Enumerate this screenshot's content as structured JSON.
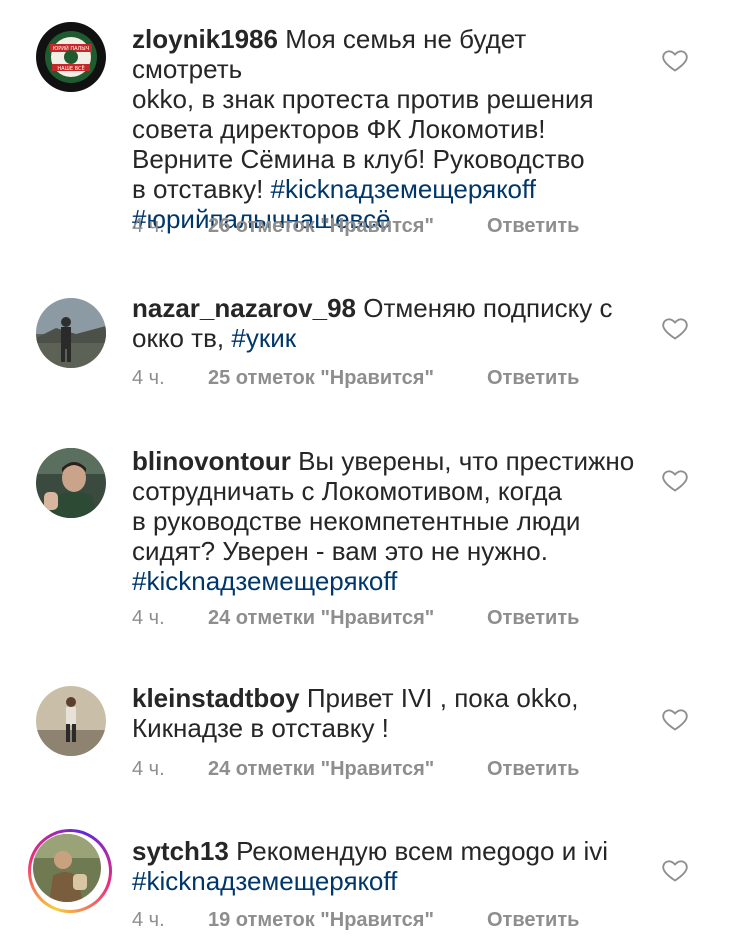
{
  "comments": [
    {
      "username": "zloynik1986",
      "text": "Моя семья не будет смотреть okko, в знак протеста против решения совета директоров ФК Локомотив! Верните Сёмина в клуб! Руководство в отставку!",
      "hashtags": [
        "#kicknадземещерякoff",
        "#юрийпалычнашевсё"
      ],
      "time": "4 ч.",
      "likes": "26 отметок \"Нравится\"",
      "reply": "Ответить",
      "avatar_icon": "club-badge-avatar"
    },
    {
      "username": "nazar_nazarov_98",
      "text": "Отменяю подписку с окко тв,",
      "hashtags": [
        "#укик"
      ],
      "time": "4 ч.",
      "likes": "25 отметок \"Нравится\"",
      "reply": "Ответить",
      "avatar_icon": "person-photo-avatar"
    },
    {
      "username": "blinovontour",
      "text": "Вы уверены, что престижно сотрудничать с Локомотивом, когда в руководстве некомпетентные люди сидят? Уверен - вам это не нужно.",
      "hashtags": [
        "#kicknадземещерякoff"
      ],
      "time": "4 ч.",
      "likes": "24 отметки \"Нравится\"",
      "reply": "Ответить",
      "avatar_icon": "person-photo-avatar"
    },
    {
      "username": "kleinstadtboy",
      "text": "Привет IVI , пока okko, Кикнадзе в отставку !",
      "hashtags": [],
      "time": "4 ч.",
      "likes": "24 отметки \"Нравится\"",
      "reply": "Ответить",
      "avatar_icon": "person-photo-avatar"
    },
    {
      "username": "sytch13",
      "text": "Рекомендую всем megogo и ivi",
      "hashtags": [
        "#kicknадземещерякoff"
      ],
      "time": "4 ч.",
      "likes": "19 отметок \"Нравится\"",
      "reply": "Ответить",
      "avatar_icon": "story-ring-avatar"
    }
  ],
  "display": {
    "c0_line1_user": "zloynik1986",
    "c0_line1_text": " Моя семья не будет смотреть",
    "c0_line2": "okko, в знак протеста против решения",
    "c0_line3": "совета директоров ФК Локомотив!",
    "c0_line4": "Верните Сёмина в клуб! Руководство",
    "c0_line5_text": "в отставку! ",
    "c0_line5_tag": "#kicknадземещерякoff",
    "c0_line6_tag": "#юрийпалычнашевсё",
    "c1_line1_user": "nazar_nazarov_98",
    "c1_line1_text": " Отменяю подписку с",
    "c1_line2_text": "окко тв, ",
    "c1_line2_tag": "#укик",
    "c2_line1_user": "blinovontour",
    "c2_line1_text": " Вы уверены, что престижно",
    "c2_line2": "сотрудничать с Локомотивом, когда",
    "c2_line3": "в руководстве некомпетентные люди",
    "c2_line4": "сидят? Уверен - вам это не нужно.",
    "c2_line5_tag": "#kicknадземещерякoff",
    "c3_line1_user": "kleinstadtboy",
    "c3_line1_text": " Привет IVI , пока okko,",
    "c3_line2": "Кикнадзе в отставку !",
    "c4_line1_user": "sytch13",
    "c4_line1_text": " Рекомендую всем megogo и ivi",
    "c4_line2_tag": "#kicknадземещерякoff"
  },
  "avatars": {
    "c0_badge_top": "ЮРИЙ ПАЛЫЧ",
    "c0_badge_bottom": "НАШЕ ВСЁ"
  },
  "colors": {
    "text": "#262626",
    "hashtag": "#00376b",
    "meta": "#8e8e8e",
    "heart_stroke": "#8e8e8e"
  }
}
